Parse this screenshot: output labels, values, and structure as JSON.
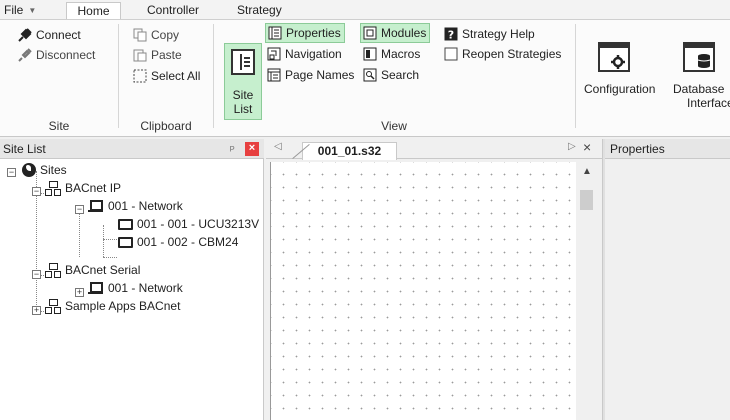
{
  "menu": {
    "file": "File",
    "tabs": [
      "Home",
      "Controller",
      "Strategy"
    ]
  },
  "ribbon": {
    "site_group": {
      "label": "Site",
      "connect": "Connect",
      "disconnect": "Disconnect"
    },
    "clipboard_group": {
      "label": "Clipboard",
      "copy": "Copy",
      "paste": "Paste",
      "select_all": "Select All"
    },
    "view_group": {
      "label": "View",
      "site_list_line1": "Site",
      "site_list_line2": "List",
      "properties": "Properties",
      "modules": "Modules",
      "strategy_help": "Strategy Help",
      "navigation": "Navigation",
      "macros": "Macros",
      "reopen_strategies": "Reopen Strategies",
      "page_names": "Page Names",
      "search": "Search"
    },
    "tools_group": {
      "configuration": "Configuration",
      "database_line1": "Database",
      "database_line2": "Interface"
    }
  },
  "site_list": {
    "title": "Site List",
    "tree": {
      "root": "Sites",
      "bacnet_ip": "BACnet IP",
      "ip_network": "001 - Network",
      "device1": "001 - 001 - UCU3213V",
      "device2": "001 - 002 - CBM24",
      "bacnet_serial": "BACnet Serial",
      "serial_network": "001 - Network",
      "sample_apps": "Sample Apps BACnet"
    }
  },
  "document": {
    "tab": "001_01.s32"
  },
  "properties": {
    "title": "Properties"
  },
  "colors": {
    "highlight": "#c6efce",
    "close_red": "#e74040"
  }
}
